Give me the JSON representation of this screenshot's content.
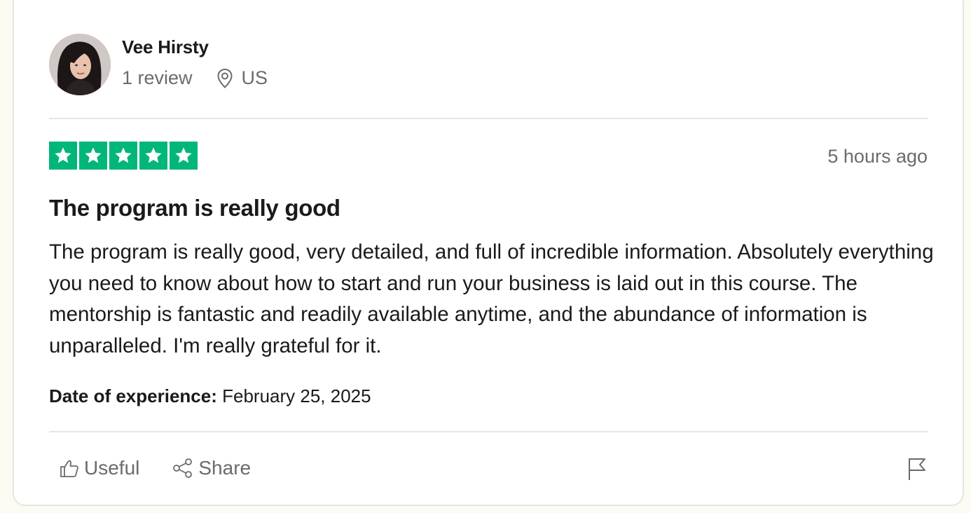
{
  "reviewer": {
    "name": "Vee Hirsty",
    "review_count": "1 review",
    "country": "US"
  },
  "rating": {
    "stars": 5,
    "max": 5,
    "color": "#00b67a"
  },
  "review": {
    "posted": "5 hours ago",
    "title": "The program is really good",
    "body": "The program is really good, very detailed, and full of incredible information. Absolutely everything you need to know about how to start and run your business is laid out in this course. The mentorship is fantastic and readily available anytime, and the abundance of information is unparalleled. I'm really grateful for it.",
    "experience_label": "Date of experience:",
    "experience_date": "February 25, 2025"
  },
  "actions": {
    "useful": "Useful",
    "share": "Share"
  },
  "icons": {
    "location": "map-pin-icon",
    "useful": "thumbs-up-icon",
    "share": "share-icon",
    "report": "flag-icon"
  }
}
